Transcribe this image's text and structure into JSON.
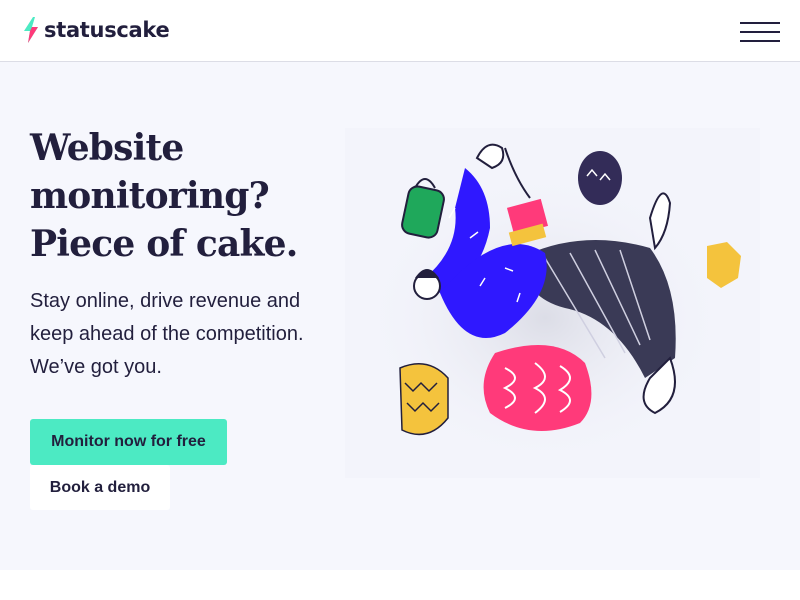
{
  "brand": {
    "name": "statuscake"
  },
  "hero": {
    "headline": [
      "Website",
      "monitoring?",
      "Piece of cake."
    ],
    "subcopy": "Stay online, drive revenue and keep ahead of the competition. We’ve got you.",
    "primary_cta": "Monitor now for free",
    "secondary_cta": "Book a demo"
  },
  "icons": {
    "menu": "hamburger-menu-icon",
    "logo": "lightning-bolt-logo"
  },
  "colors": {
    "accent": "#4ceac3",
    "text": "#221f3d",
    "hero_bg": "#f6f7fd",
    "logo_pink": "#ff3a7a"
  }
}
